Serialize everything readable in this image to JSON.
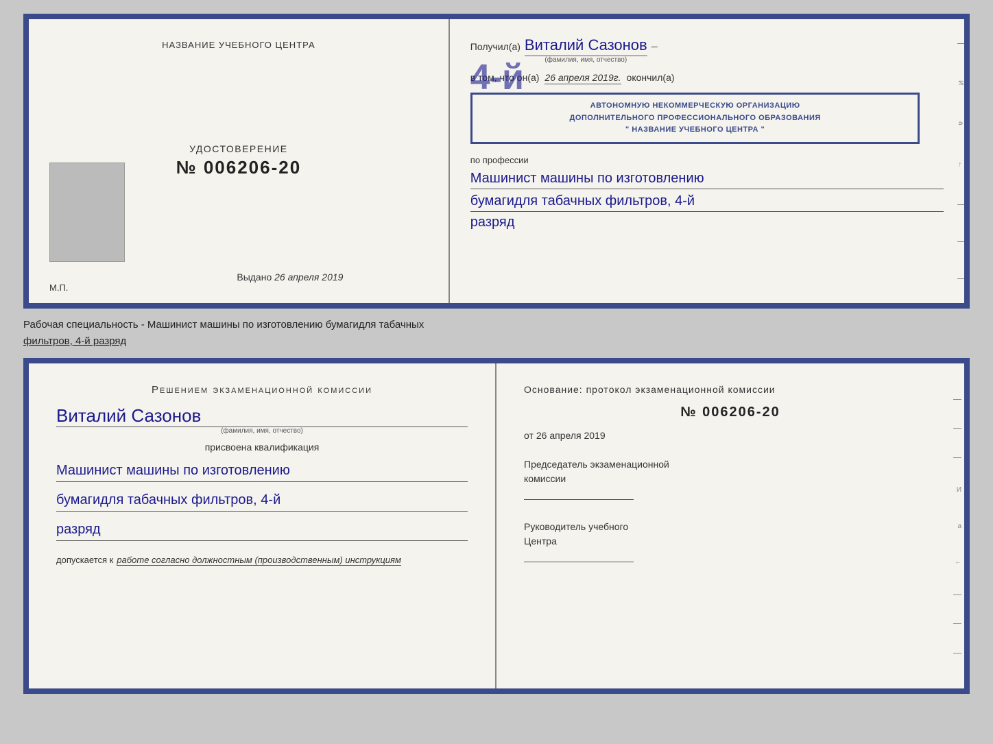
{
  "top_doc": {
    "left": {
      "title": "НАЗВАНИЕ УЧЕБНОГО ЦЕНТРА",
      "cert_label": "УДОСТОВЕРЕНИЕ",
      "cert_number": "№ 006206-20",
      "issued_label": "Выдано",
      "issued_date": "26 апреля 2019",
      "mp_label": "М.П."
    },
    "right": {
      "received_label": "Получил(а)",
      "recipient_name": "Виталий  Сазонов",
      "recipient_sub": "(фамилия, имя, отчество)",
      "in_that_label": "в том, что он(а)",
      "date_written": "26 апреля 2019г.",
      "finished_label": "окончил(а)",
      "stamp_line1": "АВТОНОМНУЮ НЕКОММЕРЧЕСКУЮ ОРГАНИЗАЦИЮ",
      "stamp_line2": "ДОПОЛНИТЕЛЬНОГО ПРОФЕССИОНАЛЬНОГО ОБРАЗОВАНИЯ",
      "stamp_line3": "\" НАЗВАНИЕ УЧЕБНОГО ЦЕНТРА \"",
      "profession_label": "по профессии",
      "profession_1": "Машинист машины по изготовлению",
      "profession_2": "бумагидля табачных фильтров, 4-й",
      "profession_3": "разряд"
    }
  },
  "description": {
    "text": "Рабочая специальность - Машинист машины по изготовлению бумагидля табачных",
    "underline_text": "фильтров, 4-й разряд"
  },
  "bottom_doc": {
    "left": {
      "decision_title": "Решением  экзаменационной  комиссии",
      "person_name": "Виталий  Сазонов",
      "name_sub": "(фамилия, имя, отчество)",
      "assigned_label": "присвоена квалификация",
      "profession_1": "Машинист машины по изготовлению",
      "profession_2": "бумагидля табачных фильтров, 4-й",
      "profession_3": "разряд",
      "allowed_label": "допускается к",
      "allowed_text": "работе согласно должностным (производственным) инструкциям"
    },
    "right": {
      "basis_label": "Основание: протокол экзаменационной  комиссии",
      "protocol_number": "№  006206-20",
      "date_prefix": "от",
      "date": "26 апреля 2019",
      "chairman_label_1": "Председатель экзаменационной",
      "chairman_label_2": "комиссии",
      "director_label_1": "Руководитель учебного",
      "director_label_2": "Центра"
    }
  }
}
